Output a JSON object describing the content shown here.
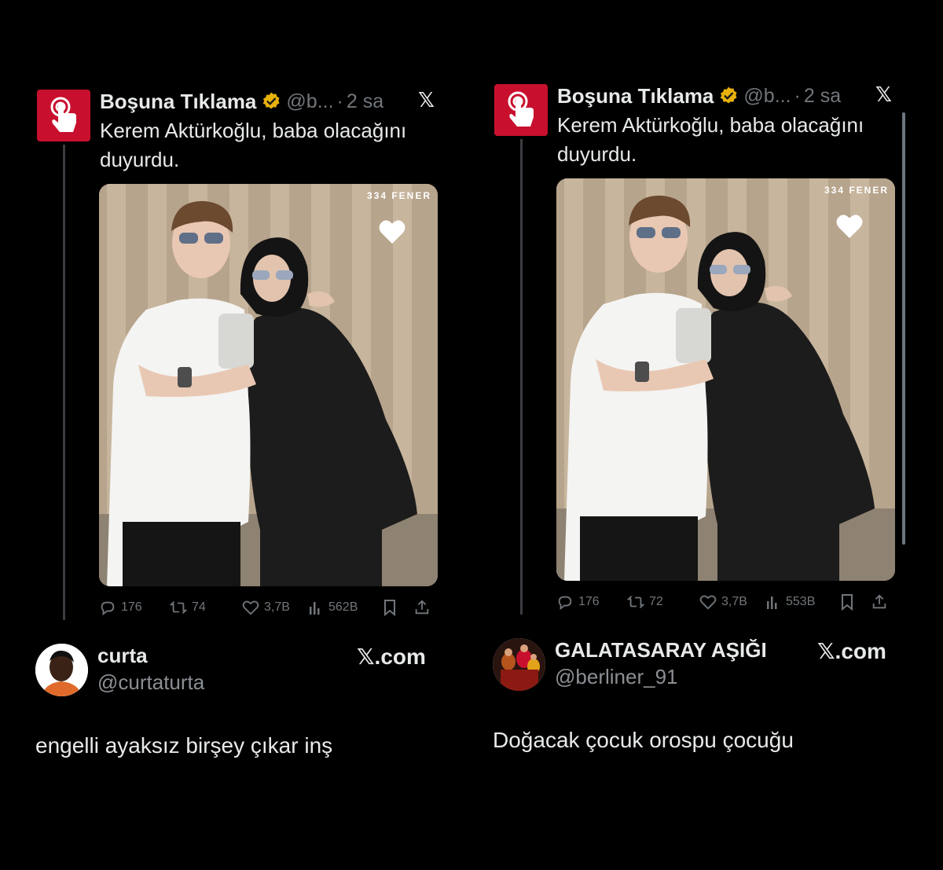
{
  "panels": [
    {
      "tweet": {
        "author": "Boşuna Tıklama",
        "handle": "@b...",
        "time_sep": "·",
        "time": "2 sa",
        "x_logo": "𝕏",
        "text": "Kerem Aktürkoğlu, baba olacağını duyurdu.",
        "media_watermark": "334 FENER",
        "stats": {
          "replies": "176",
          "retweets": "74",
          "likes": "3,7B",
          "views": "562B"
        }
      },
      "card": {
        "name": "curta",
        "handle": "@curtaturta",
        "site": "𝕏.com"
      },
      "comment": "engelli ayaksız birşey çıkar inş"
    },
    {
      "tweet": {
        "author": "Boşuna Tıklama",
        "handle": "@b...",
        "time_sep": "·",
        "time": "2 sa",
        "x_logo": "𝕏",
        "text": "Kerem Aktürkoğlu, baba olacağını duyurdu.",
        "media_watermark": "334 FENER",
        "stats": {
          "replies": "176",
          "retweets": "72",
          "likes": "3,7B",
          "views": "553B"
        }
      },
      "card": {
        "name": "GALATASARAY AŞIĞI",
        "handle": "@berliner_91",
        "site": "𝕏.com"
      },
      "comment": "Doğacak çocuk orospu çocuğu"
    }
  ],
  "icons": {
    "avatar": "pointing-hand-icon",
    "verified": "verified-badge-icon",
    "reply": "reply-icon",
    "retweet": "retweet-icon",
    "like": "heart-icon",
    "views": "views-icon",
    "bookmark": "bookmark-icon",
    "share": "share-icon"
  },
  "colors": {
    "background": "#000000",
    "text": "#e7e9ea",
    "muted": "#71767b",
    "brand_red": "#c8102e",
    "verified_gold": "#e8b10b"
  }
}
